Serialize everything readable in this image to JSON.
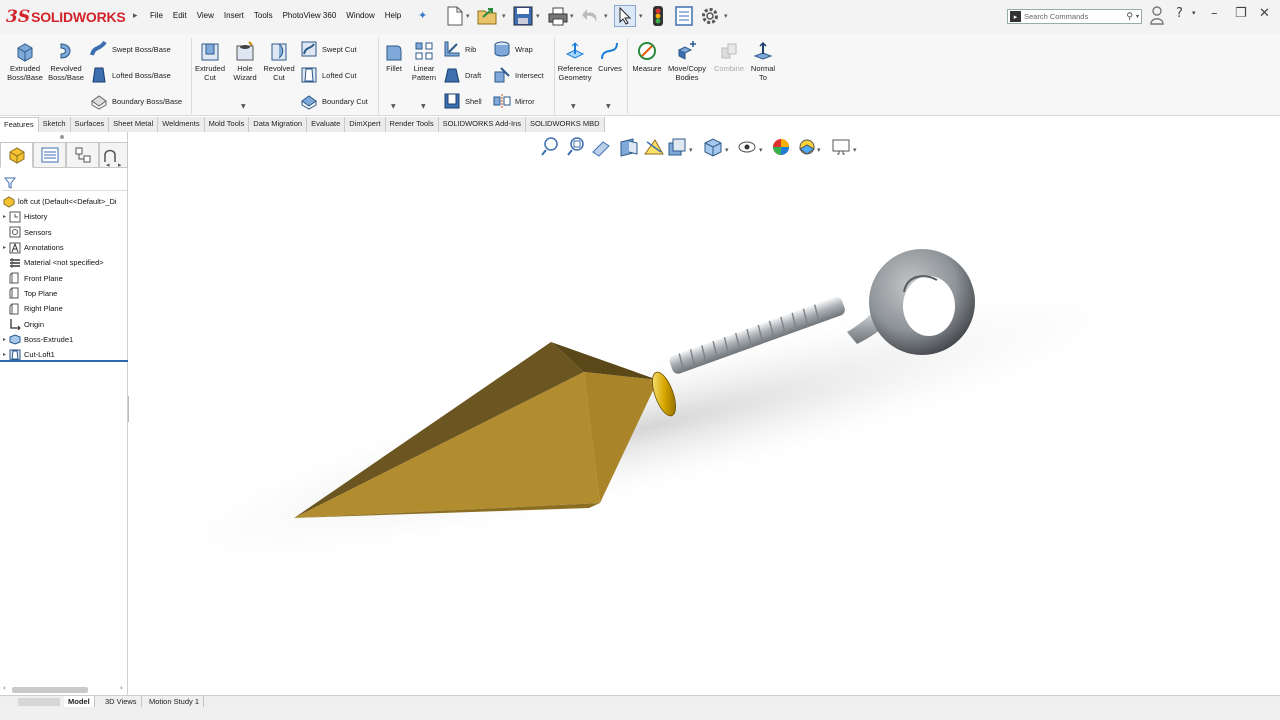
{
  "app": {
    "brand_ds": "3S",
    "brand_name": "SOLIDWORKS"
  },
  "menu": [
    "File",
    "Edit",
    "View",
    "Insert",
    "Tools",
    "PhotoView 360",
    "Window",
    "Help"
  ],
  "search": {
    "placeholder": "Search Commands"
  },
  "ribbon": {
    "extruded_boss": "Extruded Boss/Base",
    "revolved_boss": "Revolved Boss/Base",
    "swept_boss": "Swept Boss/Base",
    "lofted_boss": "Lofted Boss/Base",
    "boundary_boss": "Boundary Boss/Base",
    "extruded_cut": "Extruded Cut",
    "hole_wizard": "Hole Wizard",
    "revolved_cut": "Revolved Cut",
    "swept_cut": "Swept Cut",
    "lofted_cut": "Lofted Cut",
    "boundary_cut": "Boundary Cut",
    "fillet": "Fillet",
    "linear_pattern": "Linear Pattern",
    "rib": "Rib",
    "draft": "Draft",
    "shell": "Shell",
    "wrap": "Wrap",
    "intersect": "Intersect",
    "mirror": "Mirror",
    "reference_geometry": "Reference Geometry",
    "curves": "Curves",
    "measure": "Measure",
    "move_copy_bodies": "Move/Copy Bodies",
    "combine": "Combine",
    "normal_to": "Normal To"
  },
  "tabs": [
    "Features",
    "Sketch",
    "Surfaces",
    "Sheet Metal",
    "Weldments",
    "Mold Tools",
    "Data Migration",
    "Evaluate",
    "DimXpert",
    "Render Tools",
    "SOLIDWORKS Add-Ins",
    "SOLIDWORKS MBD"
  ],
  "tree": {
    "root": "loft cut  (Default<<Default>_Di",
    "items": [
      {
        "label": "History",
        "expandable": true,
        "icon": "history-icon"
      },
      {
        "label": "Sensors",
        "expandable": false,
        "icon": "sensors-icon"
      },
      {
        "label": "Annotations",
        "expandable": true,
        "icon": "annotations-icon"
      },
      {
        "label": "Material <not specified>",
        "expandable": false,
        "icon": "material-icon"
      },
      {
        "label": "Front Plane",
        "expandable": false,
        "icon": "plane-icon"
      },
      {
        "label": "Top Plane",
        "expandable": false,
        "icon": "plane-icon"
      },
      {
        "label": "Right Plane",
        "expandable": false,
        "icon": "plane-icon"
      },
      {
        "label": "Origin",
        "expandable": false,
        "icon": "origin-icon"
      },
      {
        "label": "Boss-Extrude1",
        "expandable": true,
        "icon": "boss-extrude-icon"
      },
      {
        "label": "Cut-Loft1",
        "expandable": true,
        "icon": "cut-loft-icon"
      }
    ]
  },
  "bottom_tabs": [
    "Model",
    "3D Views",
    "Motion Study 1"
  ],
  "colors": {
    "brand_red": "#d2232a",
    "accent_blue": "#2c6ab0",
    "blade_gold": "#b08a2c",
    "ring_gold": "#d9a800",
    "steel": "#9ea3a8"
  }
}
